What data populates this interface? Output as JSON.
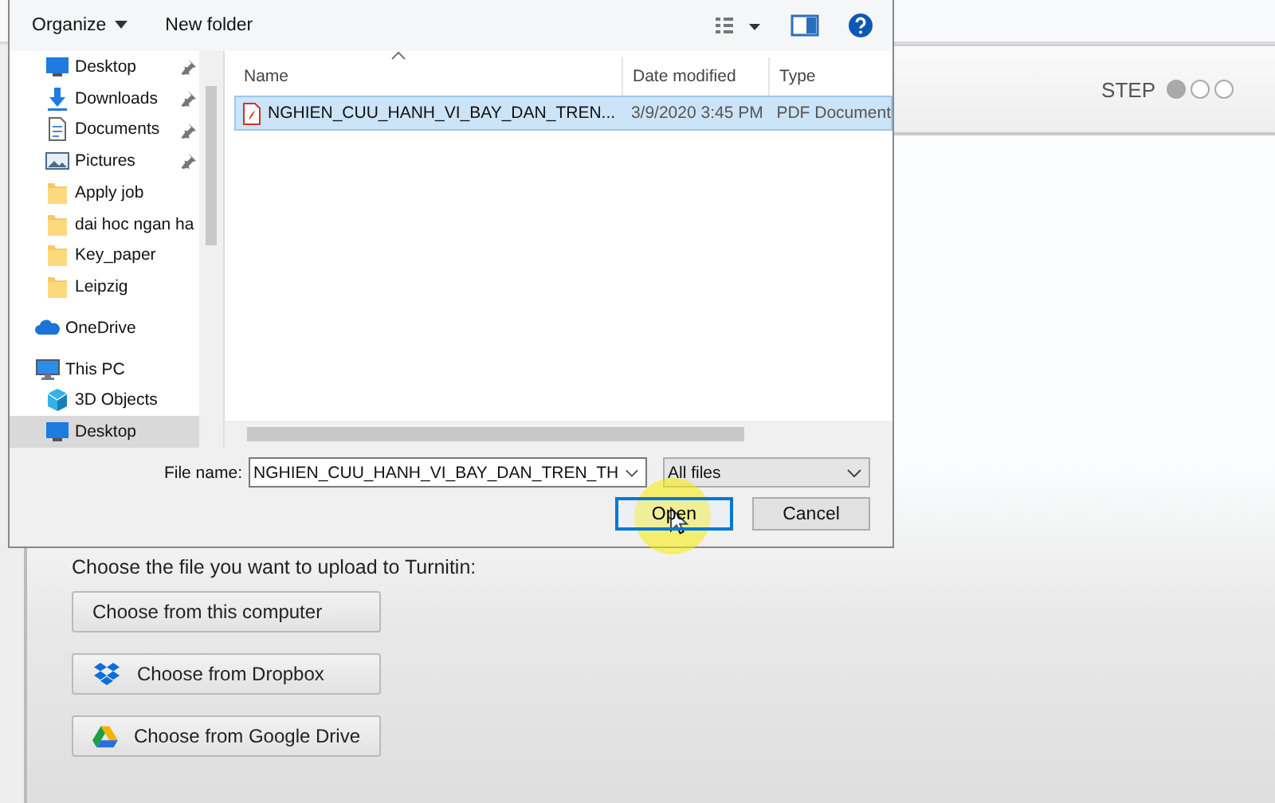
{
  "upload_page": {
    "step": {
      "label": "STEP",
      "dots": [
        {
          "selected": true
        },
        {
          "selected": false
        },
        {
          "selected": false
        }
      ]
    },
    "prompt": "Choose the file you want to upload to Turnitin:",
    "buttons": [
      {
        "kind": "computer",
        "label": "Choose from this computer"
      },
      {
        "kind": "dropbox",
        "label": "Choose from Dropbox"
      },
      {
        "kind": "drive",
        "label": "Choose from Google Drive"
      }
    ]
  },
  "dialog": {
    "toolbar": {
      "organize": "Organize",
      "new_folder": "New folder"
    },
    "sidebar": {
      "quick_access": [
        {
          "kind": "desktop",
          "label": "Desktop",
          "pinned": true,
          "selected": false
        },
        {
          "kind": "downloads",
          "label": "Downloads",
          "pinned": true,
          "selected": false
        },
        {
          "kind": "documents",
          "label": "Documents",
          "pinned": true,
          "selected": false
        },
        {
          "kind": "pictures",
          "label": "Pictures",
          "pinned": true,
          "selected": false
        },
        {
          "kind": "folder",
          "label": "Apply job",
          "pinned": false,
          "selected": false
        },
        {
          "kind": "folder",
          "label": "dai hoc ngan ha",
          "pinned": false,
          "selected": false
        },
        {
          "kind": "folder",
          "label": "Key_paper",
          "pinned": false,
          "selected": false
        },
        {
          "kind": "folder",
          "label": "Leipzig",
          "pinned": false,
          "selected": false
        }
      ],
      "items": [
        {
          "kind": "onedrive",
          "label": "OneDrive",
          "selected": false
        },
        {
          "kind": "pc",
          "label": "This PC",
          "selected": false,
          "children": [
            {
              "kind": "objects",
              "label": "3D Objects",
              "selected": false
            },
            {
              "kind": "desktop",
              "label": "Desktop",
              "selected": true
            }
          ]
        }
      ]
    },
    "table": {
      "columns": [
        "Name",
        "Date modified",
        "Type"
      ],
      "rows": [
        {
          "name": "NGHIEN_CUU_HANH_VI_BAY_DAN_TREN...",
          "date": "3/9/2020 3:45 PM",
          "type": "PDF Document",
          "selected": true
        }
      ]
    },
    "file_name_label": "File name:",
    "file_name": "NGHIEN_CUU_HANH_VI_BAY_DAN_TREN_TH",
    "filter": "All files",
    "buttons": [
      {
        "label": "Open",
        "selected": true
      },
      {
        "label": "Cancel",
        "selected": false
      }
    ]
  }
}
